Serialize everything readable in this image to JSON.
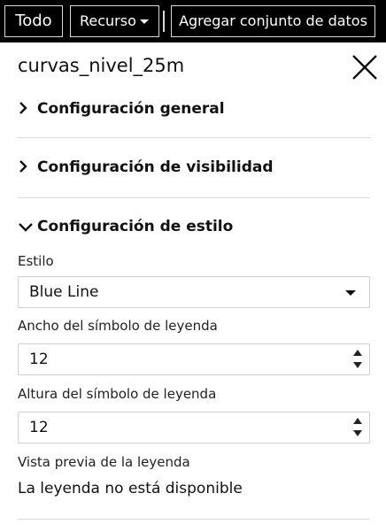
{
  "topbar": {
    "todo_label": "Todo",
    "recurso_label": "Recurso",
    "add_dataset_label": "Agregar conjunto de datos"
  },
  "panel": {
    "layer_title": "curvas_nivel_25m",
    "sections": [
      {
        "label": "Configuración general",
        "expanded": false
      },
      {
        "label": "Configuración de visibilidad",
        "expanded": false
      },
      {
        "label": "Configuración de estilo",
        "expanded": true
      }
    ],
    "style": {
      "style_label": "Estilo",
      "style_value": "Blue Line",
      "legend_width_label": "Ancho del símbolo de leyenda",
      "legend_width_value": "12",
      "legend_height_label": "Altura del símbolo de leyenda",
      "legend_height_value": "12",
      "preview_label": "Vista previa de la leyenda",
      "preview_text": "La leyenda no está disponible"
    }
  },
  "icons": {
    "close": "close-icon",
    "collapsed": "chevron-right-icon",
    "expanded": "chevron-down-icon",
    "dropdown": "caret-down-icon"
  },
  "colors": {
    "topbar_bg": "#000000",
    "topbar_text": "#ffffff",
    "divider": "#d9d9d9",
    "input_border": "#cfcfcf"
  }
}
